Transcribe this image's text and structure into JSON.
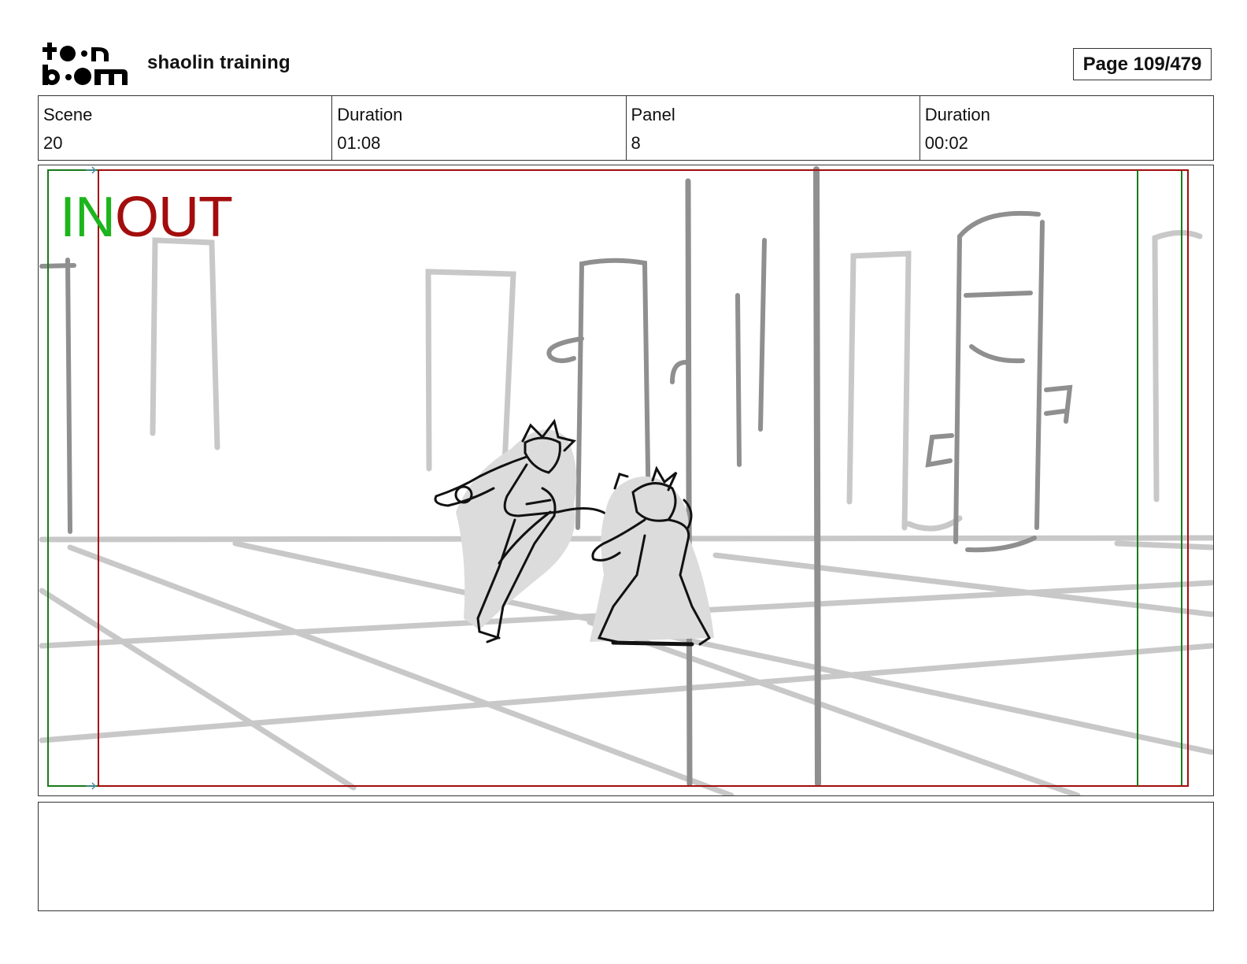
{
  "header": {
    "project_title": "shaolin training",
    "page_label": "Page 109/479",
    "logo_text": "toon boom"
  },
  "info": {
    "scene_label": "Scene",
    "scene_value": "20",
    "scene_duration_label": "Duration",
    "scene_duration_value": "01:08",
    "panel_label": "Panel",
    "panel_value": "8",
    "panel_duration_label": "Duration",
    "panel_duration_value": "00:02"
  },
  "panel": {
    "in_marker": "IN",
    "out_marker": "OUT",
    "safe_frame_color": "#a30d0d",
    "camera_frame_color": "#1a7a1a",
    "sketch_gray": "#c8c8c8",
    "sketch_dark_gray": "#8f8f8f"
  },
  "notes": {
    "text": ""
  }
}
